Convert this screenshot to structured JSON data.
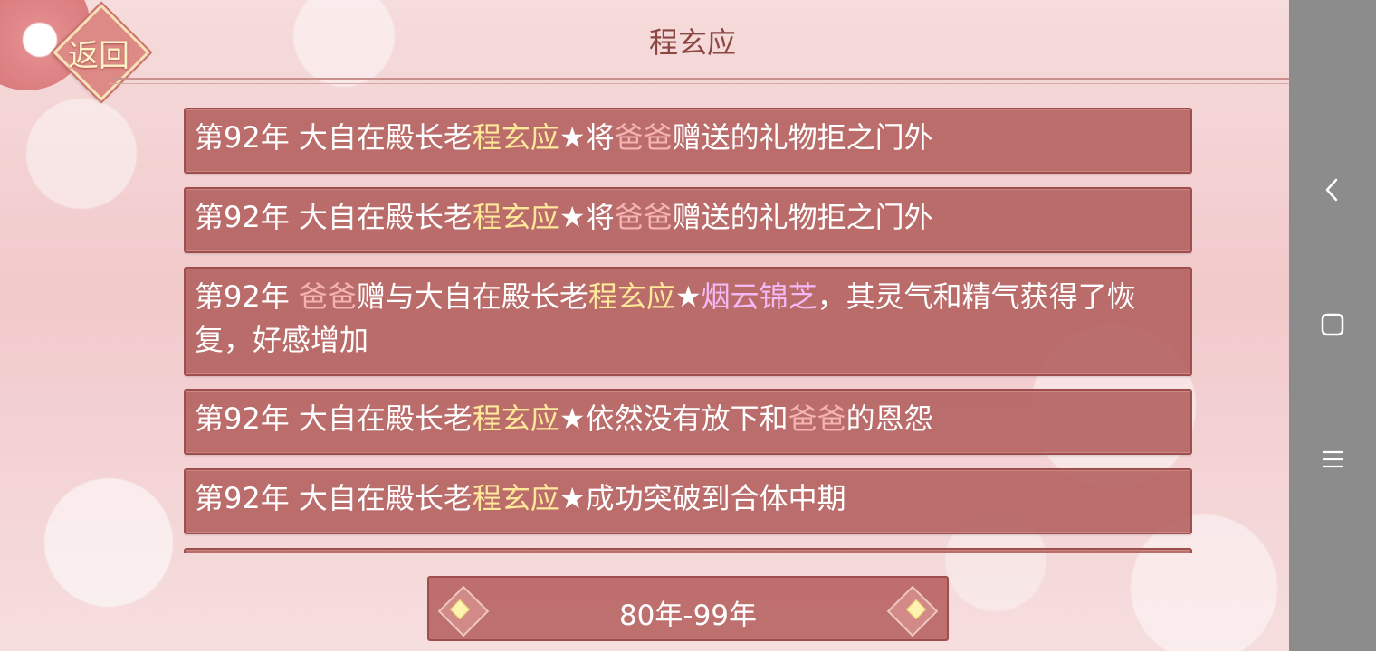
{
  "header": {
    "back_label": "返回",
    "title": "程玄应"
  },
  "log": {
    "entries": [
      {
        "parts": [
          {
            "text": "第92年 大自在殿长老",
            "style": "normal"
          },
          {
            "text": "程玄应",
            "style": "name"
          },
          {
            "text": "★将",
            "style": "normal"
          },
          {
            "text": "爸爸",
            "style": "relation"
          },
          {
            "text": "赠送的礼物拒之门外",
            "style": "normal"
          }
        ]
      },
      {
        "parts": [
          {
            "text": "第92年 大自在殿长老",
            "style": "normal"
          },
          {
            "text": "程玄应",
            "style": "name"
          },
          {
            "text": "★将",
            "style": "normal"
          },
          {
            "text": "爸爸",
            "style": "relation"
          },
          {
            "text": "赠送的礼物拒之门外",
            "style": "normal"
          }
        ]
      },
      {
        "parts": [
          {
            "text": "第92年 ",
            "style": "normal"
          },
          {
            "text": "爸爸",
            "style": "relation"
          },
          {
            "text": "赠与大自在殿长老",
            "style": "normal"
          },
          {
            "text": "程玄应",
            "style": "name"
          },
          {
            "text": "★",
            "style": "normal"
          },
          {
            "text": "烟云锦芝",
            "style": "item"
          },
          {
            "text": "，其灵气和精气获得了恢复，好感增加",
            "style": "normal"
          }
        ]
      },
      {
        "parts": [
          {
            "text": "第92年 大自在殿长老",
            "style": "normal"
          },
          {
            "text": "程玄应",
            "style": "name"
          },
          {
            "text": "★依然没有放下和",
            "style": "normal"
          },
          {
            "text": "爸爸",
            "style": "relation"
          },
          {
            "text": "的恩怨",
            "style": "normal"
          }
        ]
      },
      {
        "parts": [
          {
            "text": "第92年 大自在殿长老",
            "style": "normal"
          },
          {
            "text": "程玄应",
            "style": "name"
          },
          {
            "text": "★成功突破到合体中期",
            "style": "normal"
          }
        ]
      },
      {
        "parts": [
          {
            "text": "",
            "style": "normal"
          }
        ]
      }
    ]
  },
  "pager": {
    "range_label": "80年-99年",
    "prev_icon": "ornate-left-arrow",
    "next_icon": "ornate-right-arrow"
  },
  "system_nav": {
    "back_icon": "chevron-left-icon",
    "home_icon": "square-icon",
    "menu_icon": "hamburger-icon"
  },
  "colors": {
    "entry_bg": "#b25e5c",
    "name_highlight": "#ffe89a",
    "relation_highlight": "#f5b3b2",
    "item_highlight": "#f4b8f4",
    "title_text": "#8b4742"
  }
}
